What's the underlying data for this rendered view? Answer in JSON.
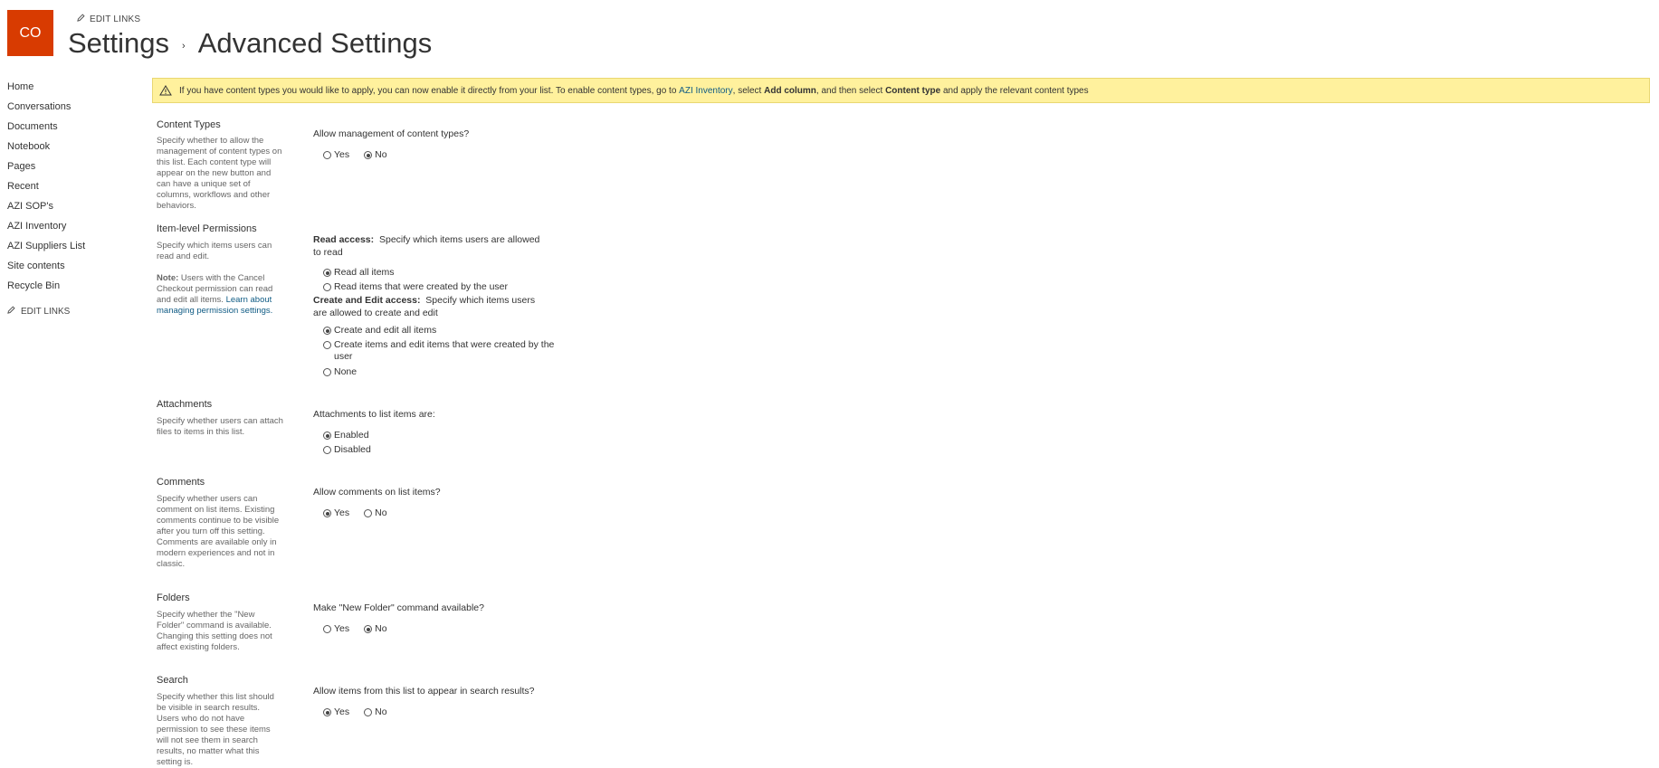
{
  "header": {
    "logo_text": "CO",
    "edit_links": "EDIT LINKS",
    "breadcrumb_root": "Settings",
    "breadcrumb_separator": "›",
    "page_title": "Advanced Settings"
  },
  "nav": {
    "items": [
      "Home",
      "Conversations",
      "Documents",
      "Notebook",
      "Pages",
      "Recent",
      "AZI SOP's",
      "AZI Inventory",
      "AZI Suppliers List",
      "Site contents",
      "Recycle Bin"
    ],
    "edit_links": "EDIT LINKS"
  },
  "banner": {
    "text1": "If you have content types you would like to apply, you can now enable it directly from your list. To enable content types, go to ",
    "link": "AZI Inventory",
    "text2": ", select ",
    "bold1": "Add column",
    "text3": ", and then select ",
    "bold2": "Content type",
    "text4": " and apply the relevant content types",
    "accent_color": "#fff19d"
  },
  "sections": {
    "content_types": {
      "title": "Content Types",
      "desc": "Specify whether to allow the management of content types on this list. Each content type will appear on the new button and can have a unique set of columns, workflows and other behaviors.",
      "question": "Allow management of content types?",
      "yes": "Yes",
      "no": "No",
      "selected": "No"
    },
    "item_permissions": {
      "title": "Item-level Permissions",
      "desc": "Specify which items users can read and edit.",
      "note_label": "Note:",
      "note_text": " Users with the Cancel Checkout permission can read and edit all items. ",
      "note_link": "Learn about managing permission settings.",
      "read_label": "Read access:",
      "read_text": "  Specify which items users are allowed to read",
      "read_all": "Read all items",
      "read_own": "Read items that were created by the user",
      "edit_label": "Create and Edit access:",
      "edit_text": "  Specify which items users are allowed to create and edit",
      "edit_all": "Create and edit all items",
      "edit_own": "Create items and edit items that were created by the user",
      "edit_none": "None"
    },
    "attachments": {
      "title": "Attachments",
      "desc": "Specify whether users can attach files to items in this list.",
      "question": "Attachments to list items are:",
      "enabled": "Enabled",
      "disabled": "Disabled",
      "selected": "Enabled"
    },
    "comments": {
      "title": "Comments",
      "desc": "Specify whether users can comment on list items. Existing comments continue to be visible after you turn off this setting. Comments are available only in modern experiences and not in classic.",
      "question": "Allow comments on list items?",
      "yes": "Yes",
      "no": "No",
      "selected": "Yes"
    },
    "folders": {
      "title": "Folders",
      "desc": "Specify whether the \"New Folder\" command is available. Changing this setting does not affect existing folders.",
      "question": "Make \"New Folder\" command available?",
      "yes": "Yes",
      "no": "No",
      "selected": "No"
    },
    "search": {
      "title": "Search",
      "desc": "Specify whether this list should be visible in search results. Users who do not have permission to see these items will not see them in search results, no matter what this setting is.",
      "question": "Allow items from this list to appear in search results?",
      "yes": "Yes",
      "no": "No",
      "selected": "Yes"
    }
  }
}
